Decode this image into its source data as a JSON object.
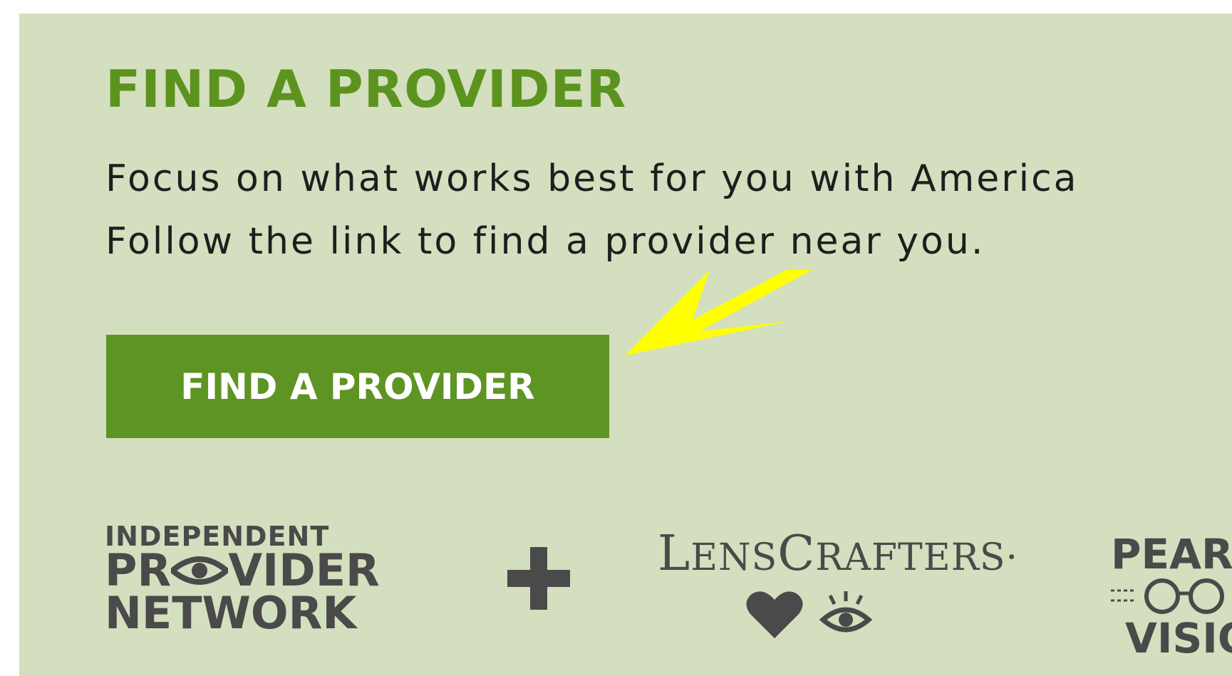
{
  "section": {
    "title": "FIND A PROVIDER",
    "description_line1": "Focus on what works best for you with America",
    "description_line2": "Follow the link to find a provider near you.",
    "button_label": "FIND A PROVIDER"
  },
  "logos": {
    "ipn": {
      "line1": "INDEPENDENT",
      "line2_a": "PR",
      "line2_b": "VIDER",
      "line3": "NETWORK"
    },
    "plus": "+",
    "lenscrafters": {
      "L": "L",
      "ens": "ENS",
      "C": "C",
      "rafters": "RAFTERS",
      "mark": "·"
    },
    "pearle": {
      "line1": "PEARL",
      "line3": "VISIO"
    }
  },
  "colors": {
    "panel_bg": "#d3dfbe",
    "title_green": "#5c931f",
    "button_green": "#5e9423",
    "logo_gray": "#4a4a4a",
    "annotation_arrow": "#ffff00"
  },
  "icons": {
    "arrow": "yellow-arrow-annotation",
    "plus": "plus-icon",
    "heart": "heart-icon",
    "eye": "eye-icon",
    "glasses": "glasses-icon"
  }
}
